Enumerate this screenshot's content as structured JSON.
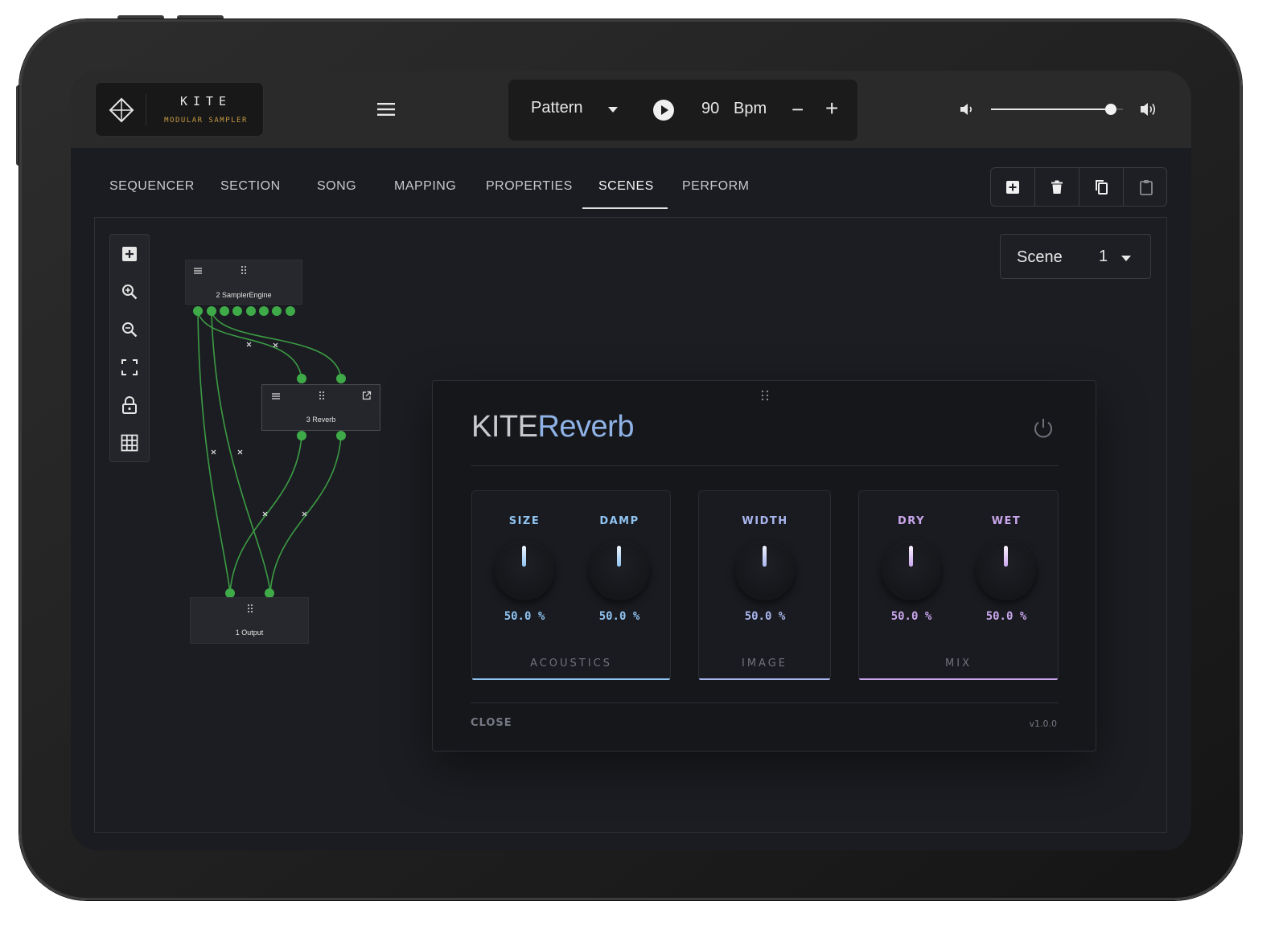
{
  "app": {
    "logo_title": "KITE",
    "logo_subtitle": "MODULAR SAMPLER"
  },
  "transport": {
    "mode_label": "Pattern",
    "tempo": "90",
    "tempo_unit": "Bpm",
    "decrement": "−",
    "increment": "+",
    "volume": 0.91
  },
  "tabs": [
    {
      "label": "SEQUENCER"
    },
    {
      "label": "SECTION"
    },
    {
      "label": "SONG"
    },
    {
      "label": "MAPPING"
    },
    {
      "label": "PROPERTIES"
    },
    {
      "label": "SCENES",
      "active": true
    },
    {
      "label": "PERFORM"
    }
  ],
  "toolbar_icons": [
    "add-icon",
    "trash-icon",
    "copy-icon",
    "paste-icon"
  ],
  "side_tools": [
    "add-node-icon",
    "zoom-in-icon",
    "zoom-out-icon",
    "fit-view-icon",
    "lock-icon",
    "grid-icon"
  ],
  "graph": {
    "nodes": [
      {
        "title": "2 SamplerEngine"
      },
      {
        "title": "3 Reverb"
      },
      {
        "title": "1 Output"
      }
    ],
    "cable_color": "#3b9c44"
  },
  "scene": {
    "label": "Scene",
    "value": "1"
  },
  "plugin": {
    "brand_prefix": "KITE",
    "brand_suffix": "Reverb",
    "groups": [
      {
        "name": "ACOUSTICS",
        "knobs": [
          {
            "label": "SIZE",
            "value": "50.0 %"
          },
          {
            "label": "DAMP",
            "value": "50.0 %"
          }
        ]
      },
      {
        "name": "IMAGE",
        "knobs": [
          {
            "label": "WIDTH",
            "value": "50.0 %"
          }
        ]
      },
      {
        "name": "MIX",
        "knobs": [
          {
            "label": "DRY",
            "value": "50.0 %"
          },
          {
            "label": "WET",
            "value": "50.0 %"
          }
        ]
      }
    ],
    "close_label": "CLOSE",
    "version": "v1.0.0",
    "colors": {
      "acoustics": "#8fc3f0",
      "image": "#a9b6ee",
      "mix": "#c9a6ec"
    }
  }
}
